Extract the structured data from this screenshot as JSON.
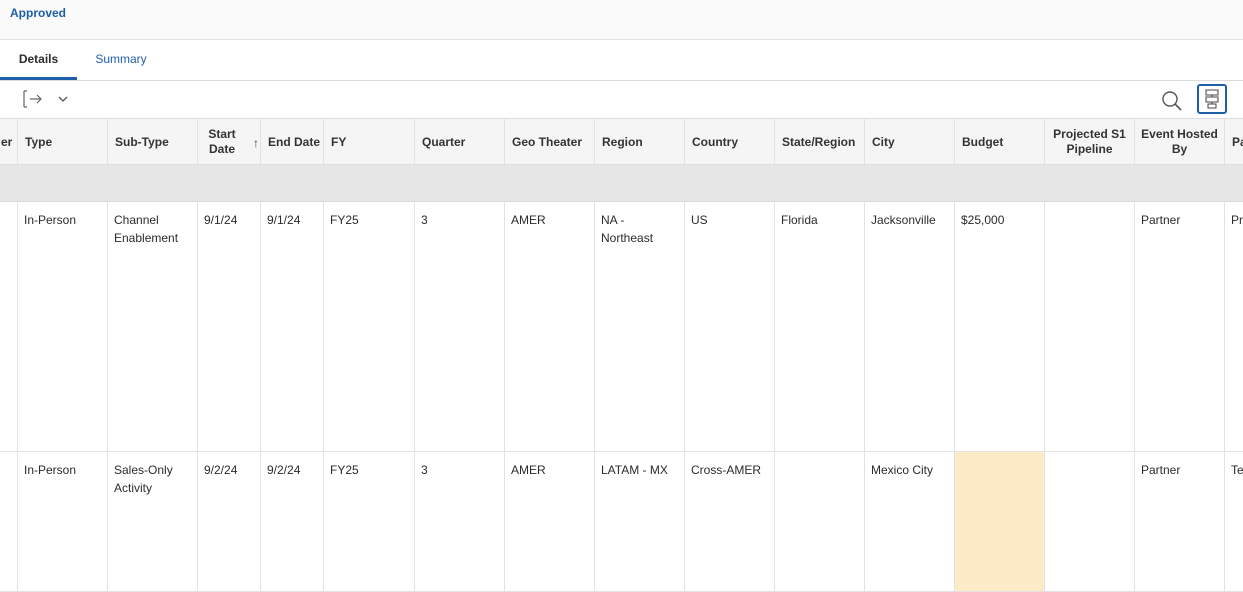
{
  "status": {
    "label": "Approved"
  },
  "tabs": [
    {
      "label": "Details",
      "active": true
    },
    {
      "label": "Summary",
      "active": false
    }
  ],
  "toolbar": {
    "export_icon": "export-icon",
    "dropdown_icon": "chevron-down-icon",
    "search_icon": "search-icon",
    "layout_icon": "column-settings-icon"
  },
  "table": {
    "columns": [
      {
        "key": "er",
        "label": "er"
      },
      {
        "key": "type",
        "label": "Type"
      },
      {
        "key": "subtype",
        "label": "Sub-Type"
      },
      {
        "key": "start",
        "label": "Start Date"
      },
      {
        "key": "end",
        "label": "End Date",
        "sort_indicator": "↑"
      },
      {
        "key": "fy",
        "label": "FY"
      },
      {
        "key": "quarter",
        "label": "Quarter"
      },
      {
        "key": "geo",
        "label": "Geo Theater"
      },
      {
        "key": "region",
        "label": "Region"
      },
      {
        "key": "country",
        "label": "Country"
      },
      {
        "key": "state",
        "label": "State/Region"
      },
      {
        "key": "city",
        "label": "City"
      },
      {
        "key": "budget",
        "label": "Budget"
      },
      {
        "key": "pipeline",
        "label": "Projected S1 Pipeline"
      },
      {
        "key": "hosted",
        "label": "Event Hosted By"
      },
      {
        "key": "pa",
        "label": "Pa"
      }
    ],
    "rows": [
      {
        "er": "",
        "type": "In-Person",
        "subtype": "Channel Enablement",
        "start": "9/1/24",
        "end": "9/1/24",
        "fy": "FY25",
        "quarter": "3",
        "geo": "AMER",
        "region": "NA - Northeast",
        "country": "US",
        "state": "Florida",
        "city": "Jacksonville",
        "budget": "$25,000",
        "pipeline": "",
        "hosted": "Partner",
        "pa": "Pr"
      },
      {
        "er": "",
        "type": "In-Person",
        "subtype": "Sales-Only Activity",
        "start": "9/2/24",
        "end": "9/2/24",
        "fy": "FY25",
        "quarter": "3",
        "geo": "AMER",
        "region": "LATAM - MX",
        "country": "Cross-AMER",
        "state": "",
        "city": "Mexico City",
        "budget": "",
        "pipeline": "",
        "hosted": "Partner",
        "pa": "Te"
      }
    ]
  },
  "colors": {
    "accent": "#1f5fa8",
    "highlight_cell": "#fdebc8",
    "group_row": "#e6e6e6"
  }
}
